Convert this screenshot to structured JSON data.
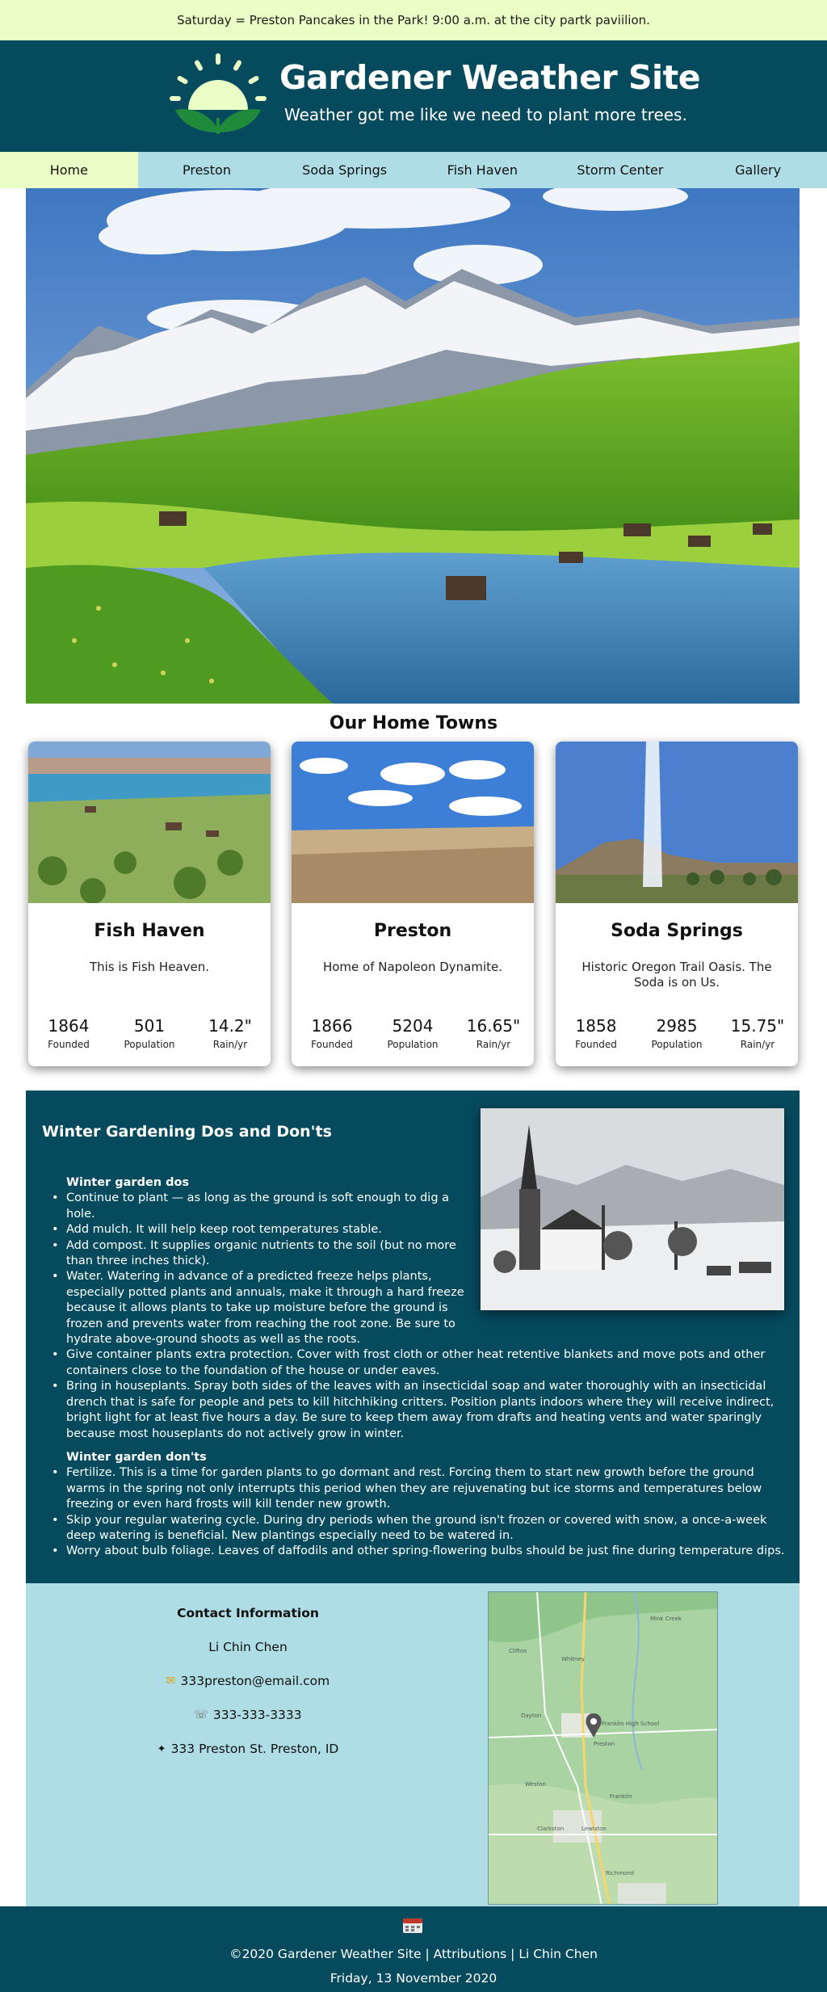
{
  "banner": {
    "text": "Saturday = Preston Pancakes in the Park! 9:00 a.m. at the city partk paviilion."
  },
  "header": {
    "title": "Gardener Weather Site",
    "tagline": "Weather got me like we need to plant more trees."
  },
  "nav": {
    "items": [
      {
        "label": "Home"
      },
      {
        "label": "Preston"
      },
      {
        "label": "Soda Springs"
      },
      {
        "label": "Fish Haven"
      },
      {
        "label": "Storm Center"
      },
      {
        "label": "Gallery"
      }
    ]
  },
  "towns": {
    "heading": "Our Home Towns",
    "cards": [
      {
        "name": "Fish Haven",
        "motto": "This is Fish Heaven.",
        "founded": "1864",
        "population": "501",
        "rain": "14.2\"",
        "founded_label": "Founded",
        "population_label": "Population",
        "rain_label": "Rain/yr"
      },
      {
        "name": "Preston",
        "motto": "Home of Napoleon Dynamite.",
        "founded": "1866",
        "population": "5204",
        "rain": "16.65\"",
        "founded_label": "Founded",
        "population_label": "Population",
        "rain_label": "Rain/yr"
      },
      {
        "name": "Soda Springs",
        "motto": "Historic Oregon Trail Oasis. The Soda is on Us.",
        "founded": "1858",
        "population": "2985",
        "rain": "15.75\"",
        "founded_label": "Founded",
        "population_label": "Population",
        "rain_label": "Rain/yr"
      }
    ]
  },
  "winter": {
    "title": "Winter Gardening Dos and Don'ts",
    "dos_heading": "Winter garden dos",
    "dos": [
      "Continue to plant — as long as the ground is soft enough to dig a hole.",
      "Add mulch. It will help keep root temperatures stable.",
      "Add compost. It supplies organic nutrients to the soil (but no more than three inches thick).",
      "Water. Watering in advance of a predicted freeze helps plants, especially potted plants and annuals, make it through a hard freeze because it allows plants to take up moisture before the ground is frozen and prevents water from reaching the root zone. Be sure to hydrate above-ground shoots as well as the roots.",
      "Give container plants extra protection. Cover with frost cloth or other heat retentive blankets and move pots and other containers close to the foundation of the house or under eaves.",
      "Bring in houseplants. Spray both sides of the leaves with an insecticidal soap and water thoroughly with an insecticidal drench that is safe for people and pets to kill hitchhiking critters. Position plants indoors where they will receive indirect, bright light for at least five hours a day. Be sure to keep them away from drafts and heating vents and water sparingly because most houseplants do not actively grow in winter."
    ],
    "donts_heading": "Winter garden don'ts",
    "donts": [
      "Fertilize. This is a time for garden plants to go dormant and rest. Forcing them to start new growth before the ground warms in the spring not only interrupts this period when they are rejuvenating but ice storms and temperatures below freezing or even hard frosts will kill tender new growth.",
      "Skip your regular watering cycle. During dry periods when the ground isn't frozen or covered with snow, a once-a-week deep watering is beneficial. New plantings especially need to be watered in.",
      "Worry about bulb foliage. Leaves of daffodils and other spring-flowering bulbs should be just fine during temperature dips."
    ]
  },
  "contact": {
    "title": "Contact Information",
    "name": "Li Chin Chen",
    "email": "333preston@email.com",
    "phone": "333-333-3333",
    "address": "333 Preston St. Preston, ID",
    "map_labels": [
      "Mink Creek",
      "Clifton",
      "Whitney",
      "Dayton",
      "Franklin High School",
      "Preston",
      "Weston",
      "Franklin",
      "Clarkston",
      "Lewiston",
      "Richmond"
    ]
  },
  "footer": {
    "copyright": "©2020 Gardener Weather Site",
    "sep1": "|",
    "attributions": "Attributions",
    "sep2": "|",
    "author": "Li Chin Chen",
    "date": "Friday, 13 November 2020"
  },
  "colors": {
    "dark_teal": "#064a5e",
    "light_blue": "#aedde6",
    "pale_green": "#eaffc5"
  }
}
